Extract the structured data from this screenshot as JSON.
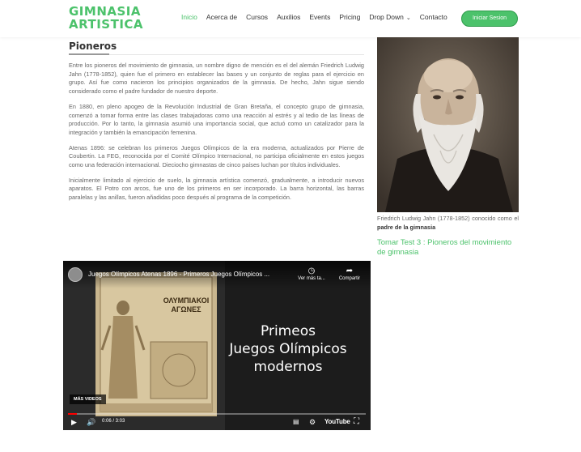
{
  "header": {
    "logo_line1": "GIMNASIA",
    "logo_line2": "ARTISTICA",
    "nav": {
      "inicio": "Inicio",
      "acerca": "Acerca de",
      "cursos": "Cursos",
      "auxilios": "Auxilios",
      "events": "Events",
      "pricing": "Pricing",
      "dropdown": "Drop Down",
      "contacto": "Contacto"
    },
    "login_label": "Iniciar Sesion"
  },
  "main": {
    "title": "Pioneros",
    "paragraphs": [
      "Entre los pioneros del movimiento de gimnasia, un nombre digno de mención es el del alemán Friedrich Ludwig Jahn (1778-1852), quien fue el primero en establecer las bases y un conjunto de reglas para el ejercicio en grupo. Así fue como nacieron los principios organizados de la gimnasia. De hecho, Jahn sigue siendo considerado como el padre fundador de nuestro deporte.",
      "En 1880, en pleno apogeo de la Revolución Industrial de Gran Bretaña, el concepto grupo de gimnasia, comenzó a tomar forma entre las clases trabajadoras como una reacción al estrés y al tedio de las líneas de producción. Por lo tanto, la gimnasia asumió una importancia social, que actuó como un catalizador para la integración y también la emancipación femenina.",
      "Atenas 1896: se celebran los primeros Juegos Olímpicos de la era moderna, actualizados por Pierre de Coubertin. La FEG, reconocida por el Comité Olímpico Internacional, no participa oficialmente en estos juegos como una federación internacional. Dieciocho gimnastas de cinco países luchan por títulos individuales.",
      "Inicialmente limitado al ejercicio de suelo, la gimnasia artística comenzó, gradualmente, a introducir nuevos aparatos. El Potro con arcos, fue uno de los primeros en ser incorporado. La barra horizontal, las barras paralelas y las anillas, fueron añadidas poco después al programa de la competición."
    ]
  },
  "sidebar": {
    "caption_text": "Friedrich Ludwig Jahn (1778-1852) conocido como el ",
    "caption_bold": "padre de la gimnasia",
    "test_link": "Tomar Test 3 : Pioneros del movimiento de gimnasia"
  },
  "video": {
    "title": "Juegos Olímpicos Atenas 1896 - Primeros Juegos Olímpicos ...",
    "watch_later": "Ver más ta...",
    "share": "Compartir",
    "poster_text": "ΟΛΥΜΠΙΑΚΟΙ ΑΓΩΝΕΣ",
    "overlay_line1": "Primeos",
    "overlay_line2": "Juegos Olímpicos",
    "overlay_line3": "modernos",
    "more_videos": "MÁS VIDEOS",
    "time": "0:06 / 3:03",
    "progress": 0.03,
    "brand": "YouTube",
    "colors": {
      "progress": "#ff0000"
    }
  },
  "colors": {
    "accent": "#4cc26b"
  }
}
